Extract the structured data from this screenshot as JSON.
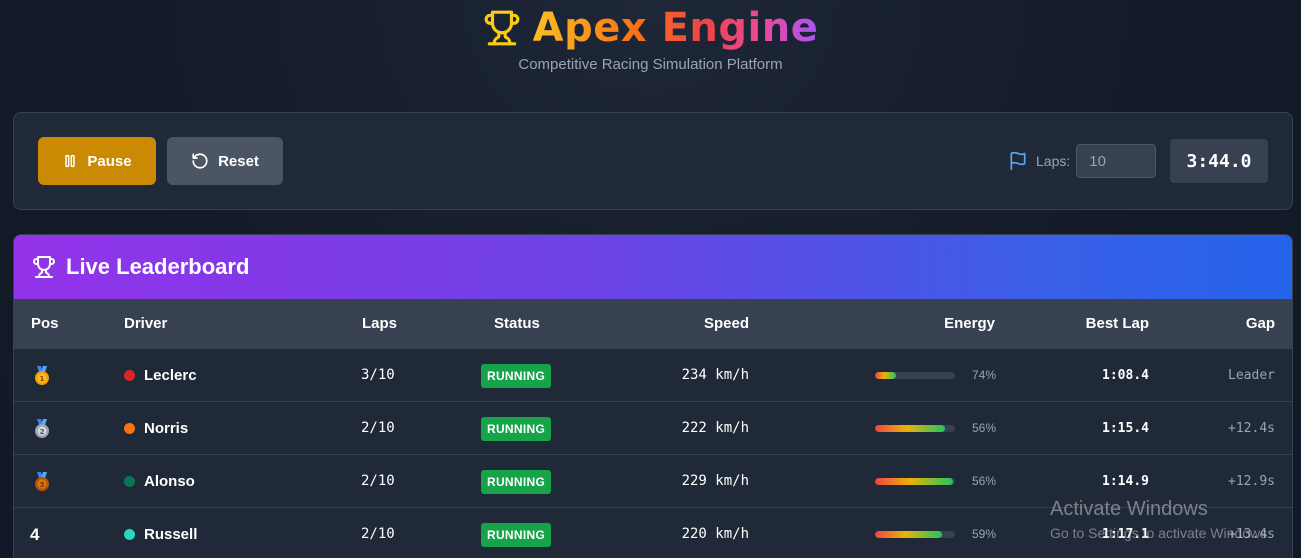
{
  "app": {
    "title": "Apex Engine",
    "subtitle": "Competitive Racing Simulation Platform"
  },
  "controls": {
    "pause_label": "Pause",
    "reset_label": "Reset",
    "laps_label": "Laps:",
    "laps_value": "10",
    "timer": "3:44.0"
  },
  "leaderboard": {
    "title": "Live Leaderboard",
    "columns": {
      "pos": "Pos",
      "driver": "Driver",
      "laps": "Laps",
      "status": "Status",
      "speed": "Speed",
      "energy": "Energy",
      "best_lap": "Best Lap",
      "gap": "Gap"
    },
    "rows": [
      {
        "pos": "1",
        "medal": "gold-medal-icon",
        "driver": "Leclerc",
        "color": "#dc2626",
        "laps": "3/10",
        "status": "RUNNING",
        "speed": "234 km/h",
        "energy": 0.26,
        "energy_label": "74%",
        "best_lap": "1:08.4",
        "gap": "Leader"
      },
      {
        "pos": "2",
        "medal": "silver-medal-icon",
        "driver": "Norris",
        "color": "#f97316",
        "laps": "2/10",
        "status": "RUNNING",
        "speed": "222 km/h",
        "energy": 0.88,
        "energy_label": "56%",
        "best_lap": "1:15.4",
        "gap": "+12.4s"
      },
      {
        "pos": "3",
        "medal": "bronze-medal-icon",
        "driver": "Alonso",
        "color": "#047857",
        "laps": "2/10",
        "status": "RUNNING",
        "speed": "229 km/h",
        "energy": 0.97,
        "energy_label": "56%",
        "best_lap": "1:14.9",
        "gap": "+12.9s"
      },
      {
        "pos": "4",
        "medal": "",
        "driver": "Russell",
        "color": "#2dd4bf",
        "laps": "2/10",
        "status": "RUNNING",
        "speed": "220 km/h",
        "energy": 0.84,
        "energy_label": "59%",
        "best_lap": "1:17.1",
        "gap": "+13.4s"
      }
    ]
  },
  "watermark": {
    "title": "Activate Windows",
    "subtitle": "Go to Settings to activate Windows."
  },
  "colors": {
    "accent_pause": "#ca8a04",
    "running": "#16a34a",
    "header_gradient_start": "#9333ea",
    "header_gradient_end": "#2563eb"
  }
}
